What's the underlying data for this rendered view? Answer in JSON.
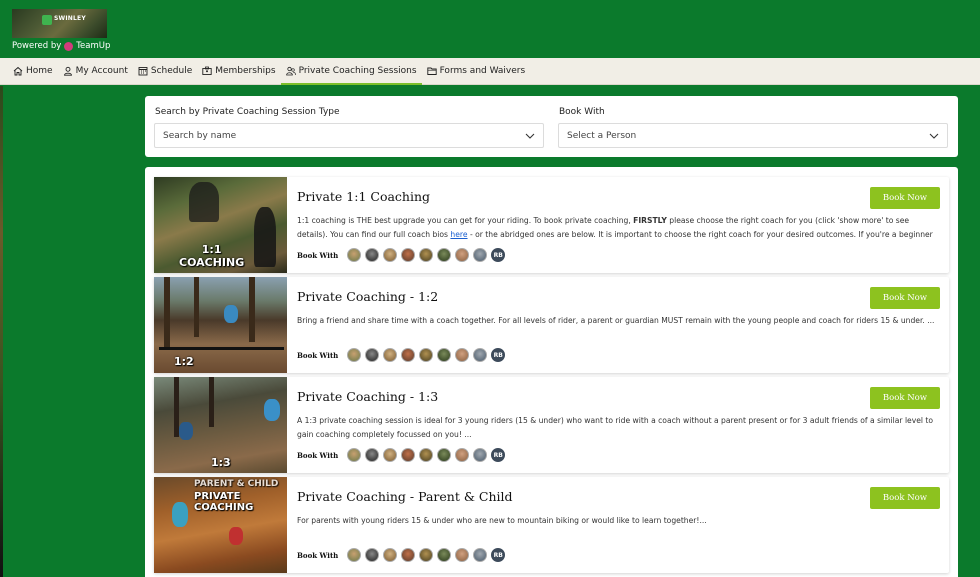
{
  "header": {
    "logo_text": "SWINLEY",
    "powered_by": "Powered by",
    "brand": "TeamUp"
  },
  "nav": {
    "items": [
      {
        "label": "Home",
        "icon": "home-icon",
        "active": false
      },
      {
        "label": "My Account",
        "icon": "user-icon",
        "active": false
      },
      {
        "label": "Schedule",
        "icon": "calendar-icon",
        "active": false
      },
      {
        "label": "Memberships",
        "icon": "id-card-icon",
        "active": false
      },
      {
        "label": "Private Coaching Sessions",
        "icon": "users-icon",
        "active": true
      },
      {
        "label": "Forms and Waivers",
        "icon": "folder-icon",
        "active": false
      }
    ]
  },
  "filters": {
    "session_type_label": "Search by Private Coaching Session Type",
    "session_type_placeholder": "Search by name",
    "book_with_label": "Book With",
    "book_with_placeholder": "Select a Person"
  },
  "colors": {
    "brand_green": "#0b7a2c",
    "button_green": "#8dc21f",
    "nav_bg": "#f1eee6",
    "link_blue": "#1a5fd0"
  },
  "sessions": [
    {
      "title": "Private 1:1 Coaching",
      "thumb_label": "1:1\nCOACHING",
      "book_label": "Book Now",
      "desc_before_bold": "1:1 coaching is THE best upgrade you can get for your riding. To book private coaching, ",
      "desc_bold": "FIRSTLY",
      "desc_after_bold": " please choose the right coach for you (click 'show more' to see details). You can find our full coach bios ",
      "desc_link": "here",
      "desc_after_link": " - or the abridged ones are below. It is important to choose the right coach for your desired outcomes. If you're a beginner or intermediate - l...",
      "book_with_label": "Book With",
      "coach_initials": "RB"
    },
    {
      "title": "Private Coaching - 1:2",
      "thumb_label": "1:2",
      "book_label": "Book Now",
      "desc": "Bring a friend and share time with a coach together. For all levels of rider, a parent or guardian MUST remain with the young people and coach for riders 15 & under. ...",
      "book_with_label": "Book With",
      "coach_initials": "RB"
    },
    {
      "title": "Private Coaching - 1:3",
      "thumb_label": "1:3",
      "book_label": "Book Now",
      "desc": "A 1:3 private coaching session is ideal for 3 young riders (15 & under) who want to ride with a coach without a parent present or for 3 adult friends of a similar level to gain coaching completely focussed on you! ...",
      "book_with_label": "Book With",
      "coach_initials": "RB"
    },
    {
      "title": "Private Coaching - Parent & Child",
      "thumb_label": "PRIVATE COACHING",
      "thumb_label_top": "PARENT & CHILD",
      "book_label": "Book Now",
      "desc": "For parents with young riders 15 & under who are new to mountain biking or would like to learn together!...",
      "book_with_label": "Book With",
      "coach_initials": "RB"
    }
  ],
  "coach_avatar_count": 8
}
